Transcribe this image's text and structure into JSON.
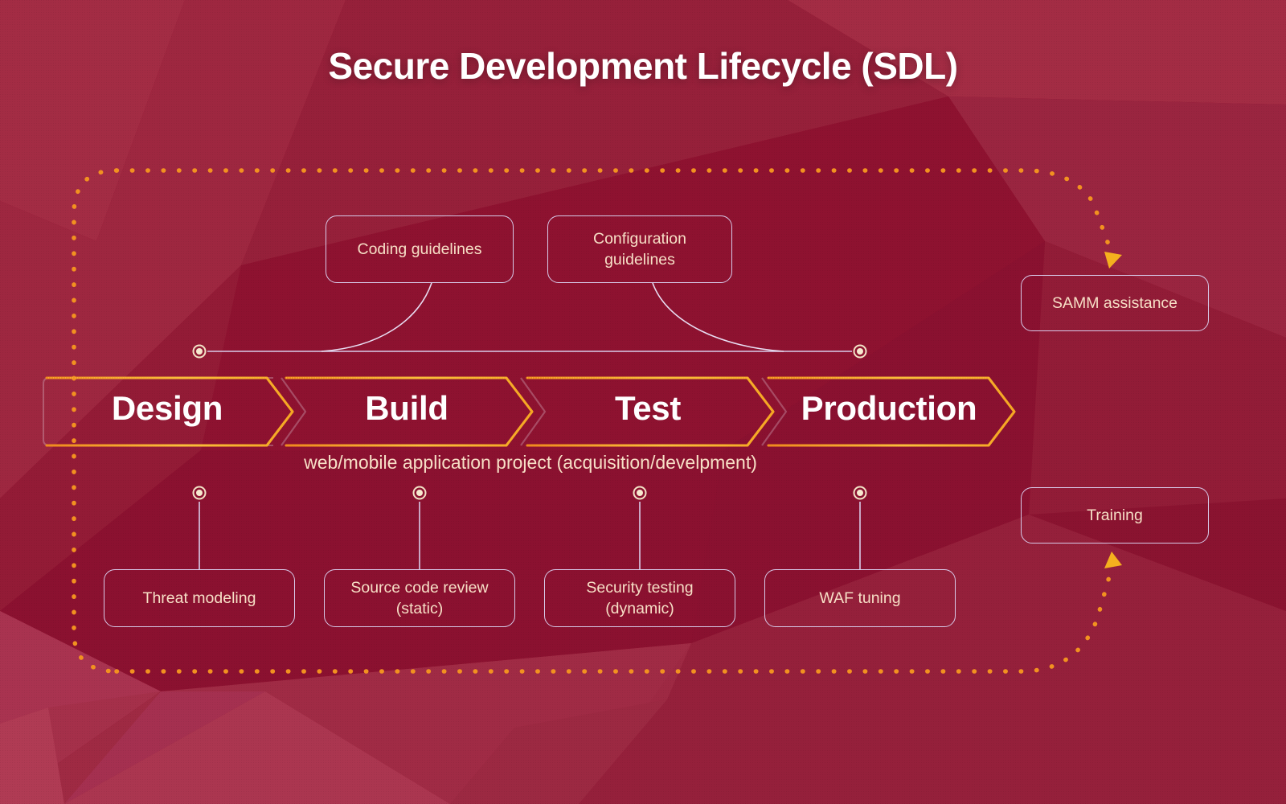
{
  "page": {
    "title": "Secure Development Lifecycle (SDL)",
    "caption": "web/mobile application project (acquisition/develpment)"
  },
  "colors": {
    "background_red": "#8E1230",
    "background_red_dark": "#7C0F2A",
    "background_red_light": "#A8304A",
    "chevron_gold": "#F5A623",
    "chevron_gold_bright": "#FBBF3B",
    "dotted_orange": "#F29120",
    "box_border_lavender": "#D7C9E8",
    "box_text_cream": "#F7DFC6",
    "stage_text_white": "#FFFFFF",
    "marker_cream": "#F3E3C6"
  },
  "pipeline": {
    "stages": [
      {
        "label": "Design"
      },
      {
        "label": "Build"
      },
      {
        "label": "Test"
      },
      {
        "label": "Production"
      }
    ]
  },
  "top_boxes": [
    {
      "label": "Coding guidelines",
      "lines": [
        "Coding guidelines"
      ]
    },
    {
      "label": "Configuration guidelines",
      "lines": [
        "Configuration",
        "guidelines"
      ]
    }
  ],
  "bottom_boxes": [
    {
      "label": "Threat modeling",
      "lines": [
        "Threat modeling"
      ]
    },
    {
      "label": "Source code review (static)",
      "lines": [
        "Source code review",
        "(static)"
      ]
    },
    {
      "label": "Security testing (dynamic)",
      "lines": [
        "Security testing",
        "(dynamic)"
      ]
    },
    {
      "label": "WAF tuning",
      "lines": [
        "WAF tuning"
      ]
    }
  ],
  "side_boxes": [
    {
      "label": "SAMM assistance"
    },
    {
      "label": "Training"
    }
  ],
  "chart_data": {
    "type": "diagram",
    "title": "Secure Development Lifecycle (SDL)",
    "subtitle": "web/mobile application project (acquisition/develpment)",
    "flow": [
      "Design",
      "Build",
      "Test",
      "Production"
    ],
    "attachments_above": [
      {
        "from": "Coding guidelines",
        "to_anchor": "left-anchor"
      },
      {
        "from": "Configuration guidelines",
        "to_anchor": "right-anchor"
      }
    ],
    "attachments_below": [
      {
        "stage": "Design",
        "item": "Threat modeling"
      },
      {
        "stage": "Build",
        "item": "Source code review (static)"
      },
      {
        "stage": "Test",
        "item": "Security testing (dynamic)"
      },
      {
        "stage": "Production",
        "item": "WAF tuning"
      }
    ],
    "feedback_loops": [
      {
        "target": "SAMM assistance",
        "direction": "clockwise-top"
      },
      {
        "target": "Training",
        "direction": "counterclockwise-bottom"
      }
    ],
    "legend": [],
    "annotations": []
  }
}
